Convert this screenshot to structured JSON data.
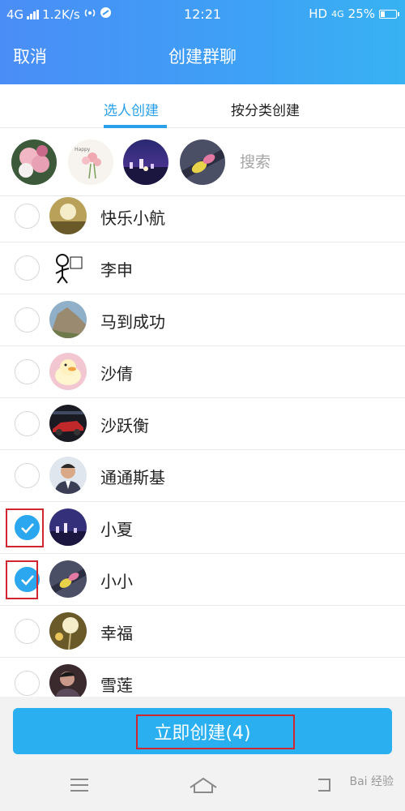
{
  "status_bar": {
    "network": "4G",
    "speed": "1.2K/s",
    "time": "12:21",
    "hd": "HD",
    "network2": "4G",
    "battery": "25%"
  },
  "header": {
    "cancel_label": "取消",
    "title": "创建群聊"
  },
  "tabs": [
    {
      "label": "选人创建",
      "active": true
    },
    {
      "label": "按分类创建",
      "active": false
    }
  ],
  "search": {
    "placeholder": "搜索"
  },
  "selected_avatars": [
    "flowers-photo",
    "flower-sketch",
    "night-city",
    "leaf-photo"
  ],
  "contacts": [
    {
      "name": "快乐小航",
      "checked": false,
      "avatar": "dandelion"
    },
    {
      "name": "李申",
      "checked": false,
      "avatar": "cartoon"
    },
    {
      "name": "马到成功",
      "checked": false,
      "avatar": "mountain"
    },
    {
      "name": "沙倩",
      "checked": false,
      "avatar": "duck"
    },
    {
      "name": "沙跃衡",
      "checked": false,
      "avatar": "car"
    },
    {
      "name": "通通斯基",
      "checked": false,
      "avatar": "portrait"
    },
    {
      "name": "小夏",
      "checked": true,
      "avatar": "night-city"
    },
    {
      "name": "小小",
      "checked": true,
      "avatar": "leaf"
    },
    {
      "name": "幸福",
      "checked": false,
      "avatar": "dandelion"
    },
    {
      "name": "雪莲",
      "checked": false,
      "avatar": "person"
    }
  ],
  "action": {
    "create_label": "立即创建(4)"
  },
  "watermark": "Bai 经验",
  "colors": {
    "accent": "#2aa0ea",
    "button": "#2aaff0",
    "highlight": "#d0262f"
  }
}
